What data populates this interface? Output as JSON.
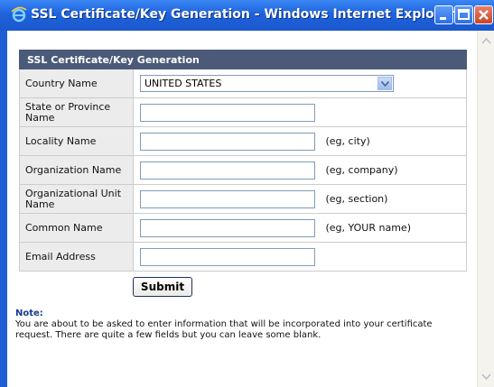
{
  "window": {
    "title": "SSL Certificate/Key Generation - Windows Internet Explorer",
    "icon": "ie-icon",
    "controls": [
      "minimize-icon",
      "maximize-icon",
      "close-icon"
    ]
  },
  "form": {
    "header": "SSL Certificate/Key Generation",
    "rows": [
      {
        "label": "Country Name",
        "type": "select",
        "value": "UNITED STATES",
        "hint": ""
      },
      {
        "label": "State or Province Name",
        "type": "text",
        "value": "",
        "hint": ""
      },
      {
        "label": "Locality Name",
        "type": "text",
        "value": "",
        "hint": "(eg, city)"
      },
      {
        "label": "Organization Name",
        "type": "text",
        "value": "",
        "hint": "(eg, company)"
      },
      {
        "label": "Organizational Unit Name",
        "type": "text",
        "value": "",
        "hint": "(eg, section)"
      },
      {
        "label": "Common Name",
        "type": "text",
        "value": "",
        "hint": "(eg, YOUR name)"
      },
      {
        "label": "Email Address",
        "type": "text",
        "value": "",
        "hint": ""
      }
    ],
    "submit_label": "Submit"
  },
  "note": {
    "label": "Note:",
    "text": "You are about to be asked to enter information that will be incorporated into your certificate request. There are quite a few fields but you can leave some blank."
  },
  "colors": {
    "titlebar": "#1f63dd",
    "form_header": "#4a5a78",
    "label_bg": "#ececec",
    "note_label": "#1c3a8c"
  }
}
